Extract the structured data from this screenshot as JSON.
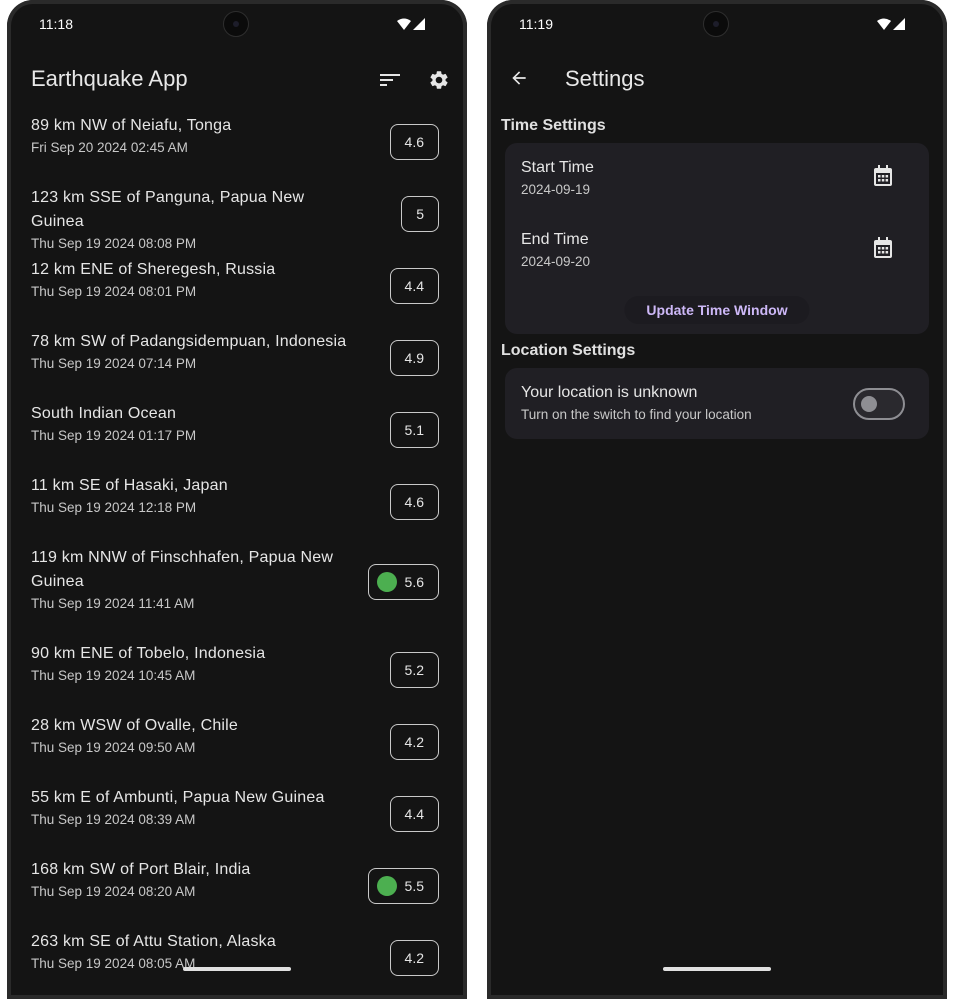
{
  "left_screen": {
    "status_time": "11:18",
    "app_title": "Earthquake App",
    "actions": {
      "sort_icon": "sort-icon",
      "settings_icon": "gear-icon"
    },
    "quakes": [
      {
        "place": "89 km NW of Neiafu, Tonga",
        "time": "Fri Sep 20 2024 02:45 AM",
        "mag": "4.6",
        "dot": false
      },
      {
        "place": "123 km SSE of Panguna, Papua New Guinea",
        "time": "Thu Sep 19 2024 08:08 PM",
        "mag": "5",
        "dot": false
      },
      {
        "place": "12 km ENE of Sheregesh, Russia",
        "time": "Thu Sep 19 2024 08:01 PM",
        "mag": "4.4",
        "dot": false
      },
      {
        "place": "78 km SW of Padangsidempuan, Indonesia",
        "time": "Thu Sep 19 2024 07:14 PM",
        "mag": "4.9",
        "dot": false
      },
      {
        "place": "South Indian Ocean",
        "time": "Thu Sep 19 2024 01:17 PM",
        "mag": "5.1",
        "dot": false
      },
      {
        "place": "11 km SE of Hasaki, Japan",
        "time": "Thu Sep 19 2024 12:18 PM",
        "mag": "4.6",
        "dot": false
      },
      {
        "place": "119 km NNW of Finschhafen, Papua New Guinea",
        "time": "Thu Sep 19 2024 11:41 AM",
        "mag": "5.6",
        "dot": true
      },
      {
        "place": "90 km ENE of Tobelo, Indonesia",
        "time": "Thu Sep 19 2024 10:45 AM",
        "mag": "5.2",
        "dot": false
      },
      {
        "place": "28 km WSW of Ovalle, Chile",
        "time": "Thu Sep 19 2024 09:50 AM",
        "mag": "4.2",
        "dot": false
      },
      {
        "place": "55 km E of Ambunti, Papua New Guinea",
        "time": "Thu Sep 19 2024 08:39 AM",
        "mag": "4.4",
        "dot": false
      },
      {
        "place": "168 km SW of Port Blair, India",
        "time": "Thu Sep 19 2024 08:20 AM",
        "mag": "5.5",
        "dot": true
      },
      {
        "place": "263 km SE of Attu Station, Alaska",
        "time": "Thu Sep 19 2024 08:05 AM",
        "mag": "4.2",
        "dot": false
      }
    ]
  },
  "right_screen": {
    "status_time": "11:19",
    "title": "Settings",
    "time_section": {
      "title": "Time Settings",
      "start_label": "Start Time",
      "start_value": "2024-09-19",
      "end_label": "End Time",
      "end_value": "2024-09-20",
      "update_button": "Update Time Window"
    },
    "location_section": {
      "title": "Location Settings",
      "label": "Your location is unknown",
      "hint": "Turn on the switch to find your location",
      "switch_on": false
    }
  },
  "colors": {
    "background": "#141414",
    "card": "#201f24",
    "accent": "#cdb8f7",
    "dot": "#4caf50"
  }
}
